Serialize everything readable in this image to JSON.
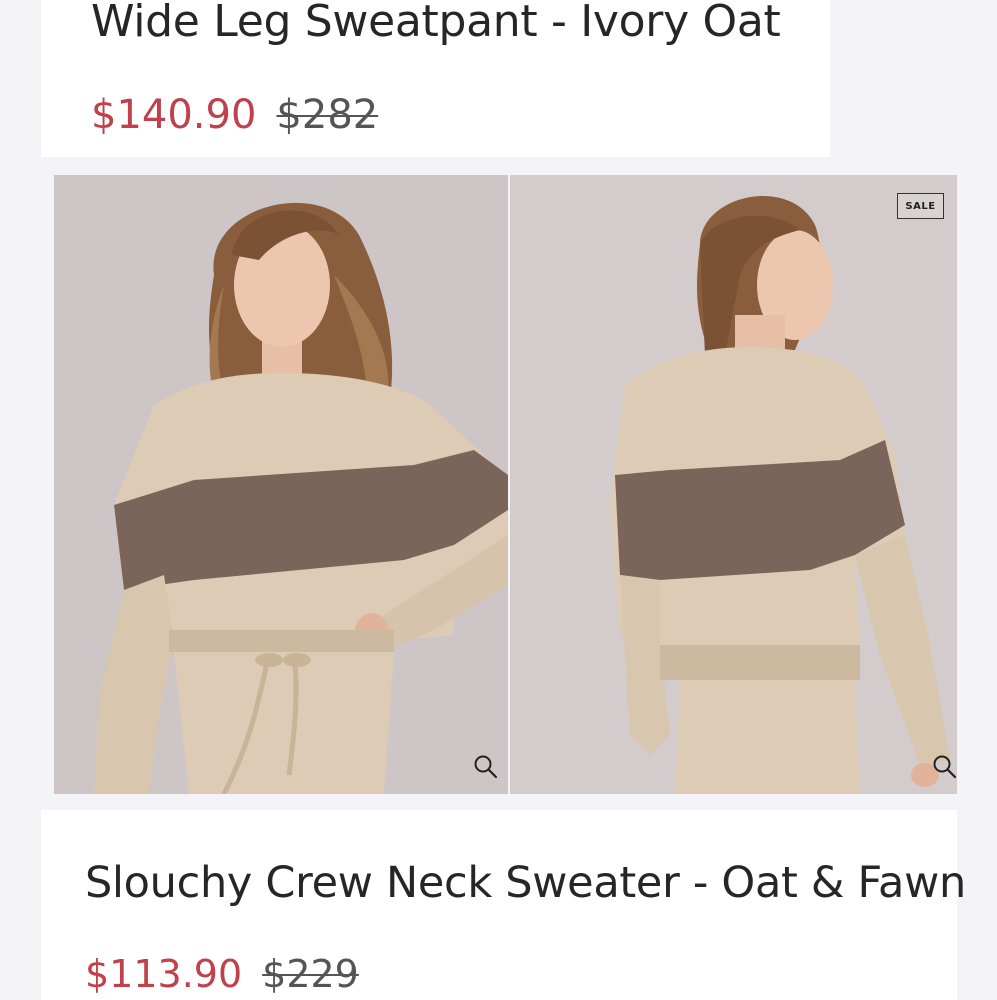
{
  "products": [
    {
      "title": "Wide Leg Sweatpant - Ivory Oat",
      "sale_price": "$140.90",
      "original_price": "$282"
    },
    {
      "title": "Slouchy Crew Neck Sweater - Oat & Fawn",
      "sale_price": "$113.90",
      "original_price": "$229",
      "badge": "SALE",
      "images": [
        {
          "alt": "Model wearing sweater, front view",
          "zoom_icon": "magnifier-icon"
        },
        {
          "alt": "Model wearing sweater, back view",
          "zoom_icon": "magnifier-icon"
        }
      ]
    }
  ],
  "colors": {
    "sale_price": "#c0404b",
    "original_price": "#555555",
    "oat": "#dccbb6",
    "fawn": "#7a6559",
    "background": "#f4f3f7"
  }
}
